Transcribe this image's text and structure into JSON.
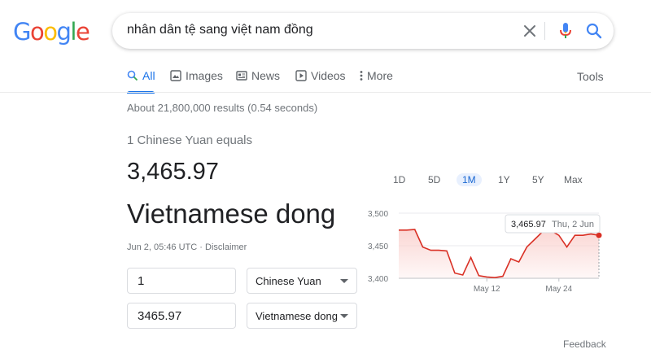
{
  "logo": {
    "text": "Google"
  },
  "search": {
    "query": "nhân dân tệ sang việt nam đồng"
  },
  "tabs": [
    {
      "label": "All",
      "icon": "search-icon"
    },
    {
      "label": "Images",
      "icon": "image-icon"
    },
    {
      "label": "News",
      "icon": "news-icon"
    },
    {
      "label": "Videos",
      "icon": "video-icon"
    },
    {
      "label": "More",
      "icon": "more-dots-icon"
    }
  ],
  "tools_label": "Tools",
  "result_stats": "About 21,800,000 results (0.54 seconds)",
  "converter": {
    "equals_text": "1 Chinese Yuan equals",
    "value": "3,465.97",
    "target_currency": "Vietnamese dong",
    "timestamp": "Jun 2, 05:46 UTC",
    "separator": " · ",
    "disclaimer": "Disclaimer",
    "from_amount": "1",
    "from_currency": "Chinese Yuan",
    "to_amount": "3465.97",
    "to_currency": "Vietnamese dong"
  },
  "ranges": [
    "1D",
    "5D",
    "1M",
    "1Y",
    "5Y",
    "Max"
  ],
  "active_range": "1M",
  "chart_data": {
    "type": "line",
    "y_ticks": [
      "3,500",
      "3,450",
      "3,400"
    ],
    "ylim": [
      3400,
      3500
    ],
    "x_labels": [
      "May 12",
      "May 24"
    ],
    "values": [
      3474,
      3474,
      3475,
      3448,
      3443,
      3443,
      3442,
      3408,
      3405,
      3432,
      3404,
      3402,
      3401,
      3403,
      3430,
      3425,
      3448,
      3460,
      3472,
      3473,
      3466,
      3448,
      3466,
      3466,
      3468,
      3466
    ],
    "tooltip": {
      "value": "3,465.97",
      "date": "Thu, 2 Jun"
    },
    "line_color": "#d93025",
    "fill_color": "#fad2cf"
  },
  "feedback_label": "Feedback",
  "colors": {
    "blue": "#4285f4",
    "red": "#ea4335",
    "yellow": "#fbbc05",
    "green": "#34a853",
    "accent": "#1a73e8"
  }
}
